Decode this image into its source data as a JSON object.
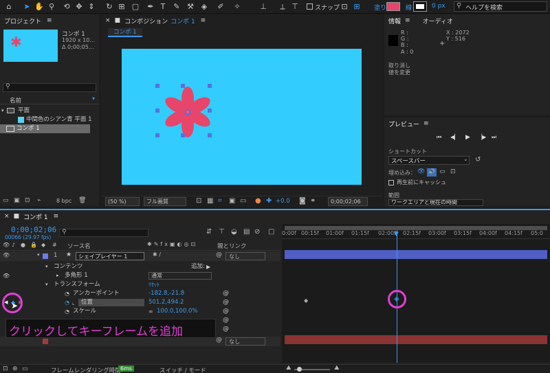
{
  "toolbar": {
    "snap_label": "スナップ",
    "fill_label": "塗り",
    "stroke_label": "線",
    "stroke_value": "0 px",
    "help_search_placeholder": "ヘルプを検索",
    "fill_color": "#e8456a"
  },
  "project": {
    "tab": "プロジェクト",
    "comp_name": "コンポ 1",
    "comp_size": "1920 x 10...",
    "comp_duration": "Δ 0;00;05...",
    "col_name": "名前",
    "items": [
      {
        "label": "平面",
        "type": "folder"
      },
      {
        "label": "中間色のシアン青 平面 1",
        "type": "solid"
      },
      {
        "label": "コンポ 1",
        "type": "comp"
      }
    ],
    "bpc": "8 bpc"
  },
  "composition": {
    "tab_prefix": "コンポジション",
    "tab_name": "コンポ 1",
    "breadcrumb": "コンポ 1",
    "zoom": "(50 %)",
    "resolution": "フル画質",
    "exposure": "+0.0",
    "timecode": "0;00;02;06",
    "canvas_color": "#33ccff",
    "flower_color": "#e8456a"
  },
  "info": {
    "tab": "情報",
    "tab_audio": "オーディオ",
    "r": "R :",
    "g": "G :",
    "b": "B :",
    "a": "A : 0",
    "x": "X : 2072",
    "y": "Y : 516",
    "undo_line1": "取り消し",
    "undo_line2": "値を変更"
  },
  "preview": {
    "tab": "プレビュー",
    "shortcut_label": "ショートカット",
    "shortcut_value": "スペースバー",
    "embed_label": "埋め込み：",
    "cache_label": "再生前にキャッシュ",
    "range_label": "範囲",
    "range_value": "ワークエリアと現在の時間"
  },
  "timeline": {
    "tab": "コンポ 1",
    "timecode": "0;00;02;06",
    "frames": "00066 (29.97 fps)",
    "col_source": "ソース名",
    "col_parent": "親とリンク",
    "ruler": [
      "0:00f",
      "00:15f",
      "01:00f",
      "01:15f",
      "02:00f",
      "02:15f",
      "03:00f",
      "03:15f",
      "04:00f",
      "04:15f",
      "05:0"
    ],
    "layer_index": "1",
    "layer_name": "シェイプレイヤー 1",
    "layer_parent": "なし",
    "contents_label": "コンテンツ",
    "add_label": "追加:",
    "polygon_label": "多角形 1",
    "blend_mode": "通常",
    "transform_label": "トランスフォーム",
    "reset_label": "ﾘｾｯﾄ",
    "anchor_label": "アンカーポイント",
    "anchor_value": "-182.8,-21.8",
    "position_label": "位置",
    "position_value": "501.2,494.2",
    "scale_label": "スケール",
    "scale_value": "100.0,100.0%",
    "layer2_parent": "なし",
    "render_time_label": "フレームレンダリング時間",
    "render_time_value": "6ms",
    "switch_mode": "スイッチ / モード"
  },
  "annotation": {
    "caption": "クリックしてキーフレームを追加",
    "color": "#e23fd6"
  }
}
